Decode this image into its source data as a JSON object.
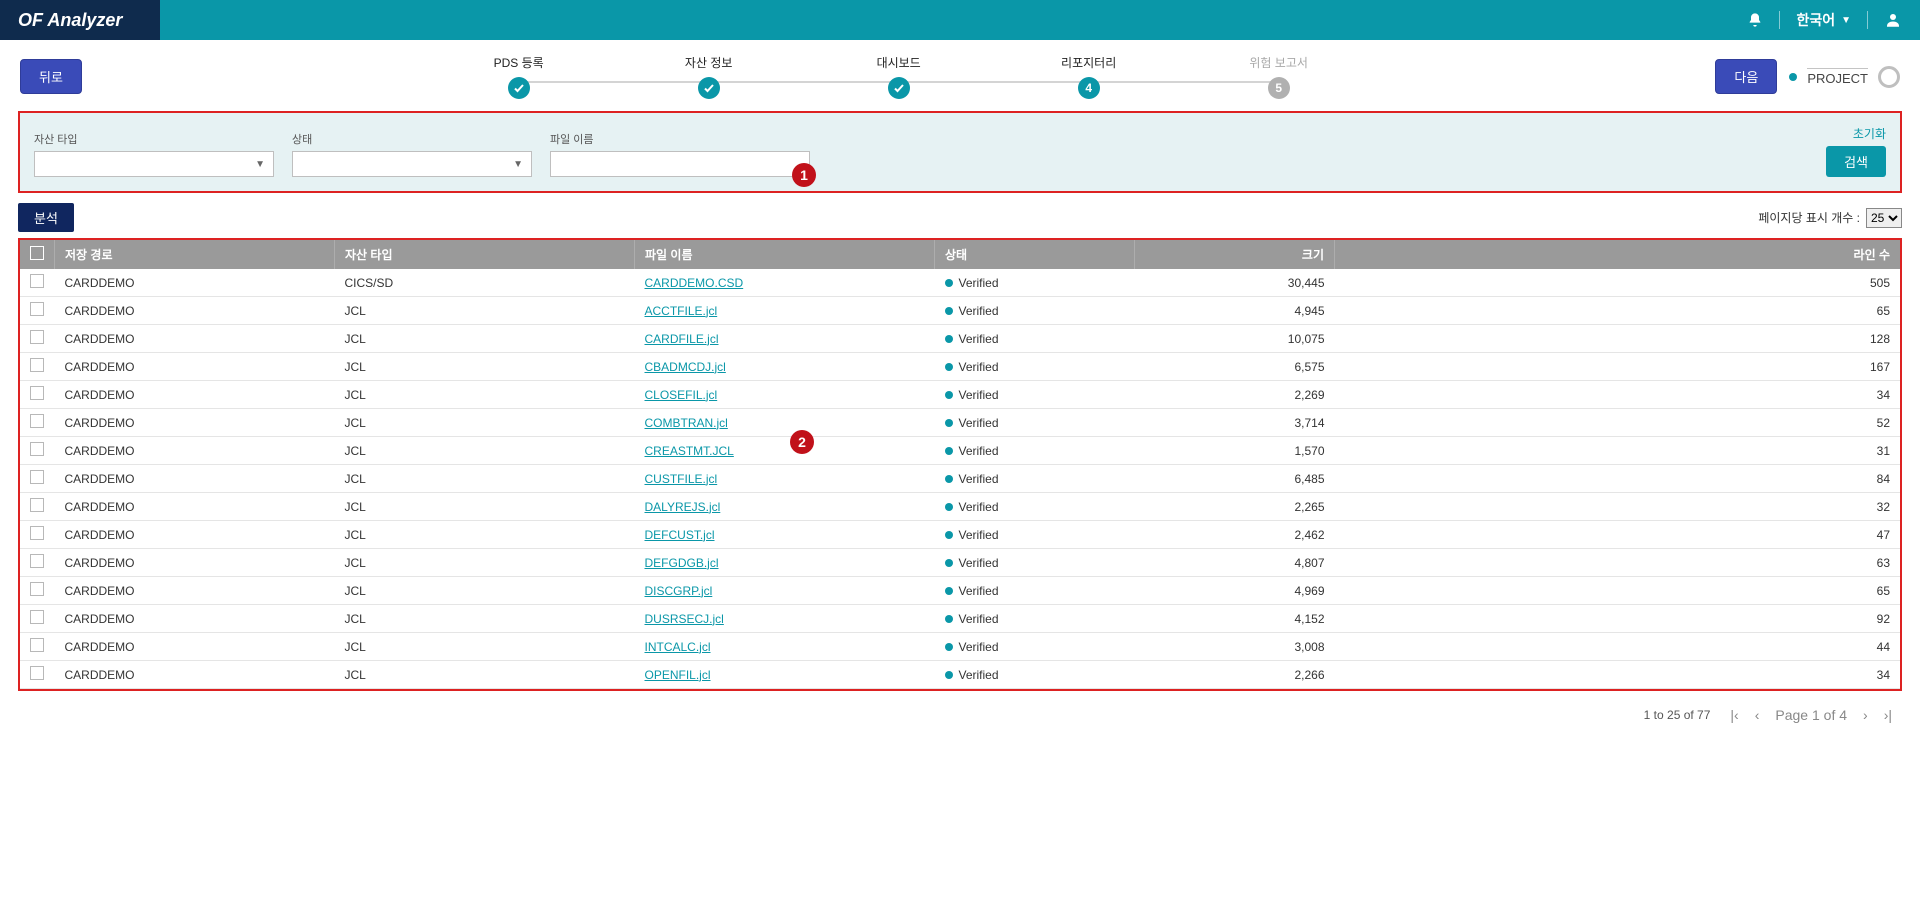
{
  "topbar": {
    "brand": "OF Analyzer",
    "language": "한국어"
  },
  "nav": {
    "back": "뒤로",
    "next": "다음",
    "project": "PROJECT",
    "steps": [
      {
        "label": "PDS 등록",
        "state": "check"
      },
      {
        "label": "자산 정보",
        "state": "check"
      },
      {
        "label": "대시보드",
        "state": "check"
      },
      {
        "label": "리포지터리",
        "state": "num-teal",
        "num": "4"
      },
      {
        "label": "위험 보고서",
        "state": "num-gray",
        "num": "5"
      }
    ]
  },
  "filter": {
    "asset_type_label": "자산 타입",
    "status_label": "상태",
    "filename_label": "파일 이름",
    "reset": "초기화",
    "search": "검색"
  },
  "mid": {
    "analyze": "분석",
    "page_size_label": "페이지당 표시 개수 :",
    "page_size_value": "25"
  },
  "table": {
    "headers": {
      "path": "저장 경로",
      "asset_type": "자산 타입",
      "filename": "파일 이름",
      "status": "상태",
      "size": "크기",
      "lines": "라인 수"
    },
    "rows": [
      {
        "path": "CARDDEMO",
        "type": "CICS/SD",
        "file": "CARDDEMO.CSD",
        "status": "Verified",
        "size": "30,445",
        "lines": "505"
      },
      {
        "path": "CARDDEMO",
        "type": "JCL",
        "file": "ACCTFILE.jcl",
        "status": "Verified",
        "size": "4,945",
        "lines": "65"
      },
      {
        "path": "CARDDEMO",
        "type": "JCL",
        "file": "CARDFILE.jcl",
        "status": "Verified",
        "size": "10,075",
        "lines": "128"
      },
      {
        "path": "CARDDEMO",
        "type": "JCL",
        "file": "CBADMCDJ.jcl",
        "status": "Verified",
        "size": "6,575",
        "lines": "167"
      },
      {
        "path": "CARDDEMO",
        "type": "JCL",
        "file": "CLOSEFIL.jcl",
        "status": "Verified",
        "size": "2,269",
        "lines": "34"
      },
      {
        "path": "CARDDEMO",
        "type": "JCL",
        "file": "COMBTRAN.jcl",
        "status": "Verified",
        "size": "3,714",
        "lines": "52"
      },
      {
        "path": "CARDDEMO",
        "type": "JCL",
        "file": "CREASTMT.JCL",
        "status": "Verified",
        "size": "1,570",
        "lines": "31"
      },
      {
        "path": "CARDDEMO",
        "type": "JCL",
        "file": "CUSTFILE.jcl",
        "status": "Verified",
        "size": "6,485",
        "lines": "84"
      },
      {
        "path": "CARDDEMO",
        "type": "JCL",
        "file": "DALYREJS.jcl",
        "status": "Verified",
        "size": "2,265",
        "lines": "32"
      },
      {
        "path": "CARDDEMO",
        "type": "JCL",
        "file": "DEFCUST.jcl",
        "status": "Verified",
        "size": "2,462",
        "lines": "47"
      },
      {
        "path": "CARDDEMO",
        "type": "JCL",
        "file": "DEFGDGB.jcl",
        "status": "Verified",
        "size": "4,807",
        "lines": "63"
      },
      {
        "path": "CARDDEMO",
        "type": "JCL",
        "file": "DISCGRP.jcl",
        "status": "Verified",
        "size": "4,969",
        "lines": "65"
      },
      {
        "path": "CARDDEMO",
        "type": "JCL",
        "file": "DUSRSECJ.jcl",
        "status": "Verified",
        "size": "4,152",
        "lines": "92"
      },
      {
        "path": "CARDDEMO",
        "type": "JCL",
        "file": "INTCALC.jcl",
        "status": "Verified",
        "size": "3,008",
        "lines": "44"
      },
      {
        "path": "CARDDEMO",
        "type": "JCL",
        "file": "OPENFIL.jcl",
        "status": "Verified",
        "size": "2,266",
        "lines": "34"
      }
    ]
  },
  "pager": {
    "range": "1 to 25 of 77",
    "page_label": "Page 1 of 4"
  },
  "markers": {
    "m1": "1",
    "m2": "2"
  }
}
